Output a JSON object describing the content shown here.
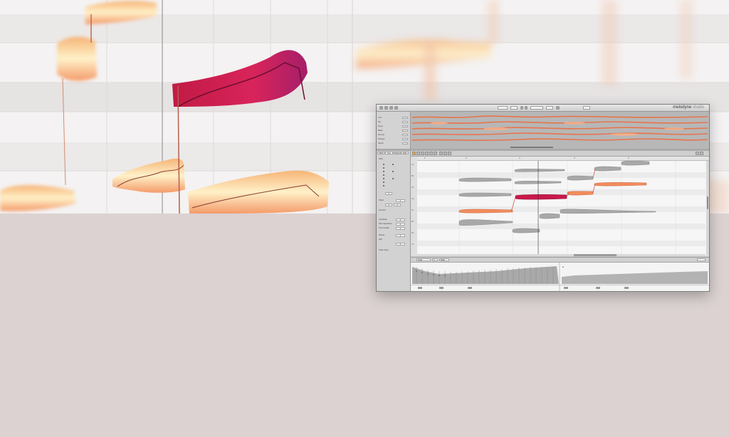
{
  "app": {
    "title": "melodyne",
    "title_suffix": "studio",
    "accent_color": "#e9a23b",
    "note_color": "#c9184a",
    "note_color_secondary": "#f28c5c"
  },
  "titlebar": {
    "buttons": [
      "play-button",
      "stop-button",
      "record-button",
      "loop-button"
    ],
    "fields": [
      "tempo-field",
      "signature-field",
      "position-field"
    ]
  },
  "tracks": {
    "names": [
      "Vox",
      "Gtr",
      "Keys",
      "Bass",
      "Drums",
      "Strings",
      "Synth"
    ]
  },
  "inspector": {
    "tabs": [
      "Pitch",
      "Note",
      "Tempo",
      "Edit"
    ],
    "active_tab": "Note",
    "labels": [
      "Pitch",
      "Offset",
      "Formant",
      "Amplitude",
      "Note Separation",
      "Time Handle",
      "Vibrato",
      "Drift",
      "Scale Snap"
    ],
    "fields": [
      "0",
      "0",
      "0",
      "0",
      "0",
      "0",
      "0",
      "0",
      "0"
    ]
  },
  "editor": {
    "tools": [
      "main-tool",
      "pitch-tool",
      "formant-tool",
      "amplitude-tool",
      "time-tool",
      "separation-tool"
    ],
    "ruler": [
      "1",
      "2",
      "3",
      "4",
      "5"
    ],
    "keys": [
      "C4",
      "B3",
      "A3",
      "G3",
      "F3",
      "E3",
      "D3",
      "C3"
    ]
  },
  "bottom_panel": {
    "fields": [
      "Scale",
      "C",
      "Major"
    ]
  }
}
